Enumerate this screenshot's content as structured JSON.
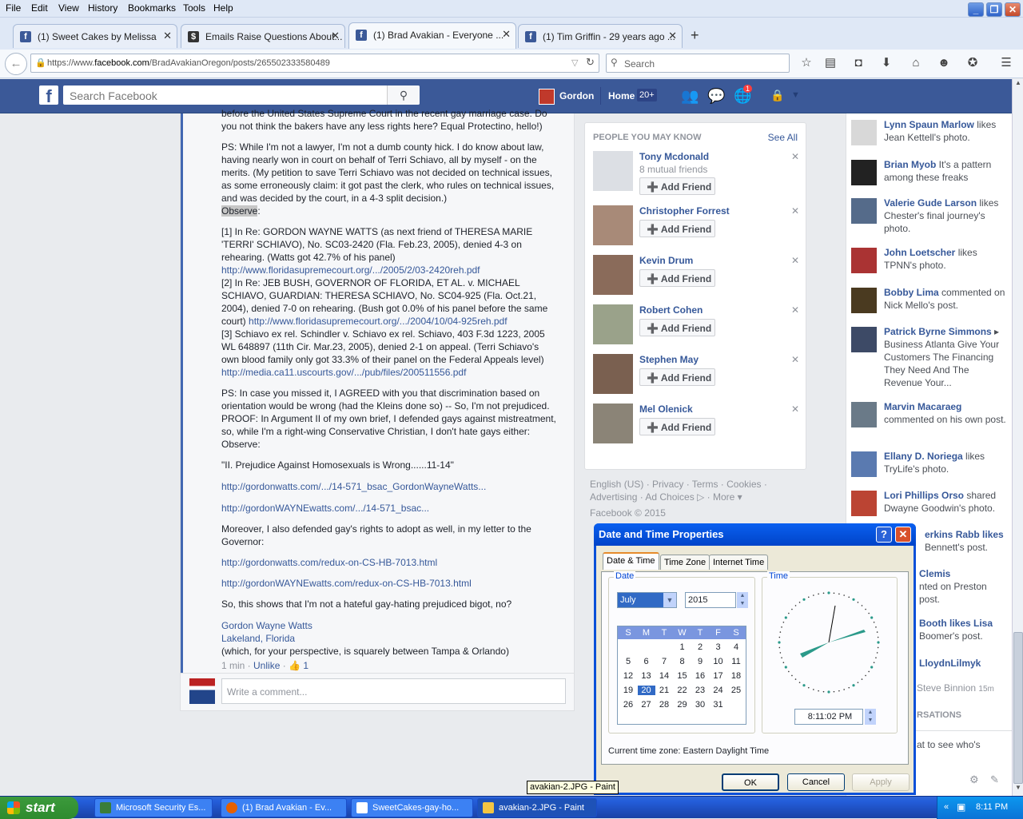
{
  "menu": [
    "File",
    "Edit",
    "View",
    "History",
    "Bookmarks",
    "Tools",
    "Help"
  ],
  "tabs": [
    {
      "title": "(1) Sweet Cakes by Melissa",
      "icon": "f"
    },
    {
      "title": "Emails Raise Questions About...",
      "icon": "$"
    },
    {
      "title": "(1) Brad Avakian - Everyone ...",
      "icon": "f",
      "active": true
    },
    {
      "title": "(1) Tim Griffin - 29 years ago ...",
      "icon": "f"
    }
  ],
  "nav": {
    "url_prefix": "https://www.",
    "url_domain": "facebook.com",
    "url_path": "/BradAvakianOregon/posts/265502333580489",
    "search_placeholder": "Search"
  },
  "fb": {
    "search_placeholder": "Search Facebook",
    "user": "Gordon",
    "home": "Home",
    "home_badge": "20+",
    "notif_badge": "1"
  },
  "post": {
    "para0": "before the United States Supreme Court in the recent gay marriage case. Do you not think the bakers have any less rights here? Equal Protectino, hello!)",
    "para1": "PS: While I'm not a lawyer, I'm not a dumb county hick. I do know about law, having nearly won in court on behalf of Terri Schiavo, all by myself - on the merits. (My petition to save Terri Schiavo was not decided on technical issues, as some erroneously claim: it got past the clerk, who rules on technical issues, and was decided by the court, in a 4-3 split decision.)",
    "observe": "Observe",
    "cite1": "[1] In Re: GORDON WAYNE WATTS (as next friend of THERESA MARIE 'TERRI' SCHIAVO), No. SC03-2420 (Fla. Feb.23, 2005), denied 4-3 on rehearing. (Watts got 42.7% of his panel)",
    "cite1_link": "http://www.floridasupremecourt.org/.../2005/2/03-2420reh.pdf",
    "cite2": "[2] In Re: JEB BUSH, GOVERNOR OF FLORIDA, ET AL. v. MICHAEL SCHIAVO, GUARDIAN: THERESA SCHIAVO, No. SC04-925 (Fla. Oct.21, 2004), denied 7-0 on rehearing. (Bush got 0.0% of his panel before the same court)",
    "cite2_link": "http://www.floridasupremecourt.org/.../2004/10/04-925reh.pdf",
    "cite3": "[3] Schiavo ex rel. Schindler v. Schiavo ex rel. Schiavo, 403 F.3d 1223, 2005 WL 648897 (11th Cir. Mar.23, 2005), denied 2-1 on appeal. (Terri Schiavo's own blood family only got 33.3% of their panel on the Federal Appeals level)",
    "cite3_link": "http://media.ca11.uscourts.gov/.../pub/files/200511556.pdf",
    "para2": "PS: In case you missed it, I AGREED with you that discrimination based on orientation would be wrong (had the Kleins done so) -- So, I'm not prejudiced. PROOF: In Argument II of my own brief, I defended gays against mistreatment, so, while I'm a right-wing Conservative Christian, I don't hate gays either: Observe:",
    "quote": "\"II. Prejudice Against Homosexuals is Wrong......11-14\"",
    "link1": "http://gordonwatts.com/.../14-571_bsac_GordonWayneWatts...",
    "link2": "http://gordonWAYNEwatts.com/.../14-571_bsac...",
    "para3": "Moreover, I also defended gay's rights to adopt as well, in my letter to the Governor:",
    "link3": "http://gordonwatts.com/redux-on-CS-HB-7013.html",
    "link4": "http://gordonWAYNEwatts.com/redux-on-CS-HB-7013.html",
    "para4": "So, this shows that I'm not a hateful gay-hating prejudiced bigot, no?",
    "sig_name": "Gordon Wayne Watts",
    "sig_loc": "Lakeland, Florida",
    "sig_note": "(which, for your perspective, is squarely between Tampa & Orlando)",
    "meta_time": "1 min",
    "meta_unlike": "Unlike",
    "meta_likes": "1",
    "comment_placeholder": "Write a comment..."
  },
  "pymk": {
    "title": "PEOPLE YOU MAY KNOW",
    "see_all": "See All",
    "add_label": "Add Friend",
    "people": [
      {
        "name": "Tony Mcdonald",
        "mutual": "8 mutual friends"
      },
      {
        "name": "Christopher Forrest",
        "mutual": ""
      },
      {
        "name": "Kevin Drum",
        "mutual": ""
      },
      {
        "name": "Robert Cohen",
        "mutual": ""
      },
      {
        "name": "Stephen May",
        "mutual": ""
      },
      {
        "name": "Mel Olenick",
        "mutual": ""
      }
    ]
  },
  "footer": {
    "line1": "English (US) · Privacy · Terms · Cookies ·",
    "line2": "Advertising · Ad Choices ▷ · More ▾",
    "line3": "Facebook © 2015"
  },
  "ticker": [
    {
      "name": "Lynn Spaun Marlow",
      "text": " likes Jean Kettell's photo."
    },
    {
      "name": "Brian Myob",
      "text": " It's a pattern among these freaks"
    },
    {
      "name": "Valerie Gude Larson",
      "text": " likes Chester's final journey's photo."
    },
    {
      "name": "John Loetscher",
      "text": " likes TPNN's photo."
    },
    {
      "name": "Bobby Lima",
      "text": " commented on Nick Mello's post."
    },
    {
      "name": "Patrick Byrne Simmons",
      "text": " ▸ Business Atlanta Give Your Customers The Financing They Need And The Revenue Your..."
    },
    {
      "name": "Marvin Macaraeg",
      "text": " commented on his own post."
    },
    {
      "name": "Ellany D. Noriega",
      "text": " likes TryLife's photo."
    },
    {
      "name": "Lori Phillips Orso",
      "text": " shared Dwayne Goodwin's photo."
    }
  ],
  "ticker_hidden": {
    "t1": "erkins Rabb likes",
    "t1b": "Bennett's post.",
    "t2": "Clemis",
    "t2b": "nted on Preston",
    "t2c": "post.",
    "t3": "Booth likes Lisa",
    "t3b": "Boomer's post.",
    "t4": "LloydnLilmyk",
    "t5": "Steve Binnion",
    "t5t": "15m",
    "t6": "RSATIONS",
    "t7": "at to see who's"
  },
  "dialog": {
    "title": "Date and Time Properties",
    "tabs": [
      "Date & Time",
      "Time Zone",
      "Internet Time"
    ],
    "date_label": "Date",
    "time_label": "Time",
    "month": "July",
    "year": "2015",
    "weekdays": [
      "S",
      "M",
      "T",
      "W",
      "T",
      "F",
      "S"
    ],
    "days": [
      "1",
      "2",
      "3",
      "4",
      "5",
      "6",
      "7",
      "8",
      "9",
      "10",
      "11",
      "12",
      "13",
      "14",
      "15",
      "16",
      "17",
      "18",
      "19",
      "20",
      "21",
      "22",
      "23",
      "24",
      "25",
      "26",
      "27",
      "28",
      "29",
      "30",
      "31"
    ],
    "selected_day": "20",
    "time": "8:11:02 PM",
    "tz": "Current time zone:  Eastern Daylight Time",
    "ok": "OK",
    "cancel": "Cancel",
    "apply": "Apply"
  },
  "tooltip": "avakian-2.JPG - Paint",
  "taskbar": {
    "start": "start",
    "items": [
      "Microsoft Security Es...",
      "(1) Brad Avakian - Ev...",
      "SweetCakes-gay-ho...",
      "avakian-2.JPG - Paint"
    ],
    "clock": "8:11 PM"
  }
}
